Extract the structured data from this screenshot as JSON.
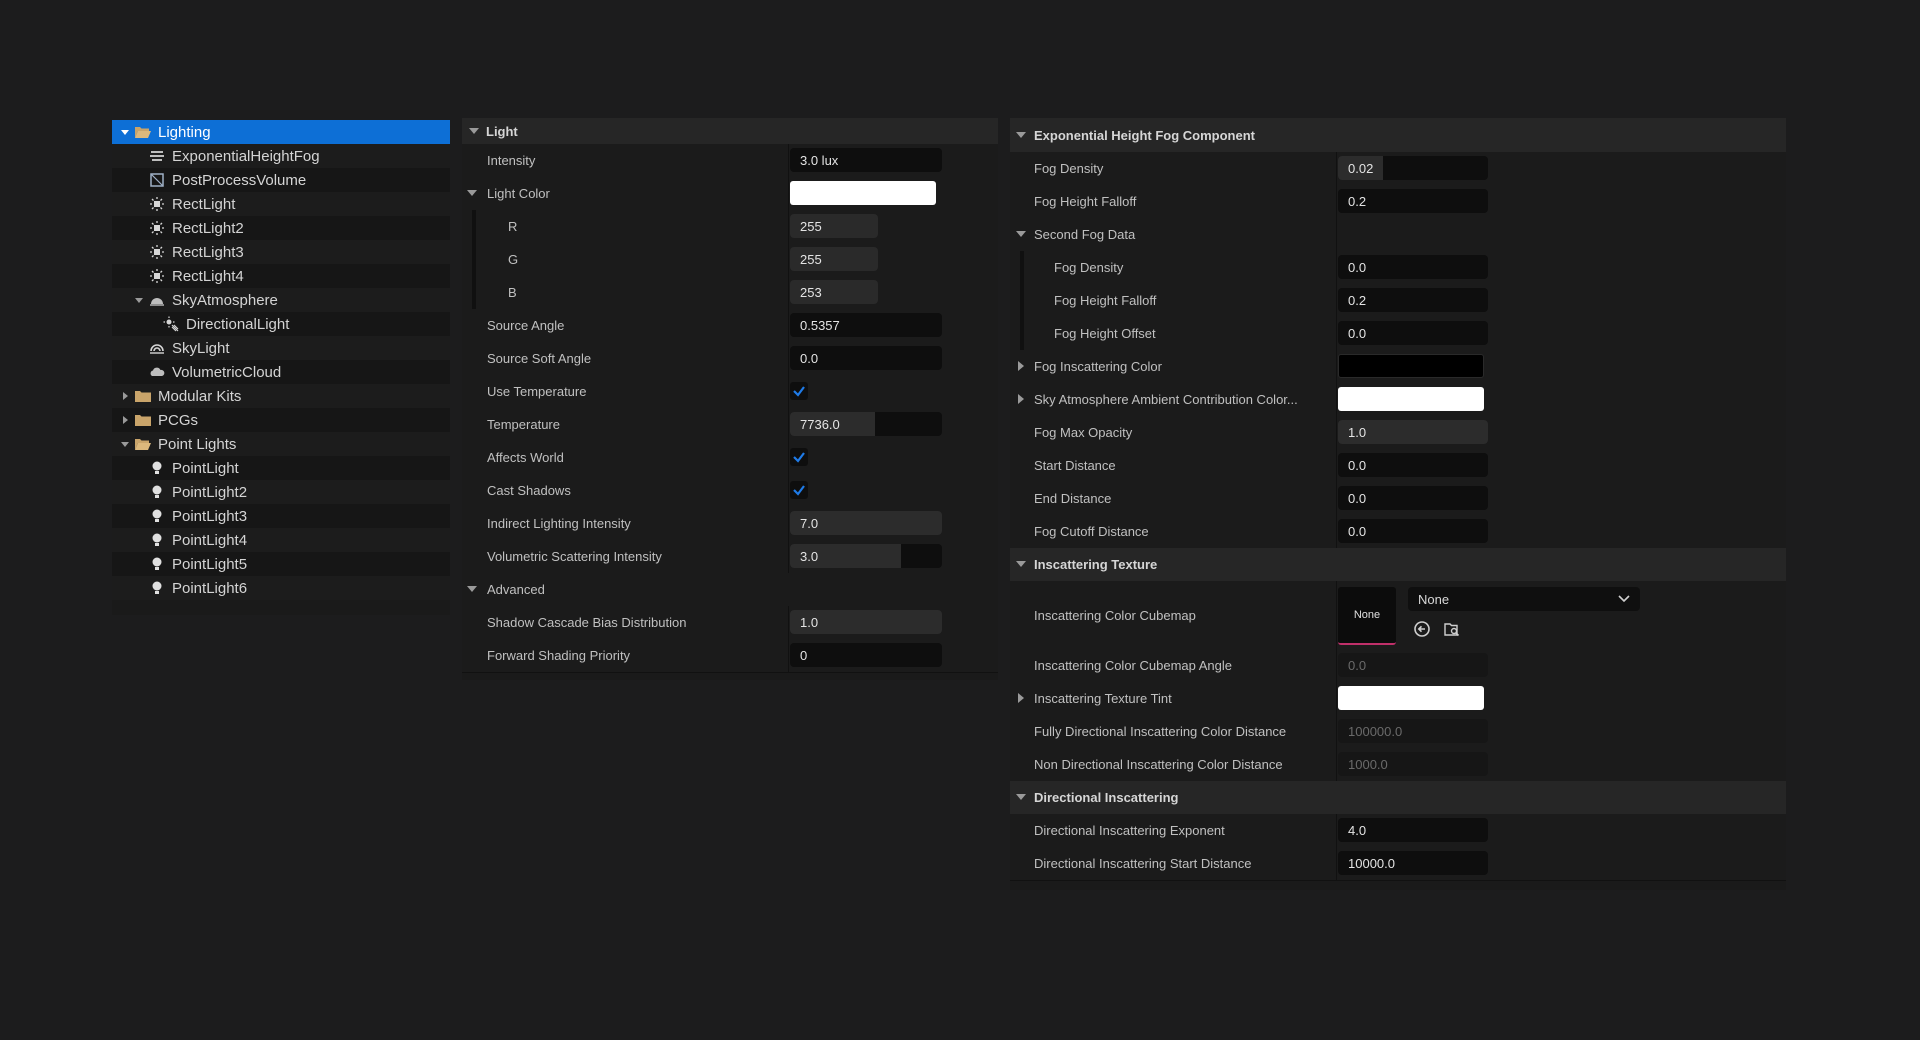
{
  "outliner": {
    "items": [
      {
        "label": "Lighting",
        "icon": "folder-open-icon",
        "depth": 0,
        "arrow": "expanded",
        "selected": true
      },
      {
        "label": "ExponentialHeightFog",
        "icon": "fog-icon",
        "depth": 1,
        "arrow": "none"
      },
      {
        "label": "PostProcessVolume",
        "icon": "post-process-icon",
        "depth": 1,
        "arrow": "none"
      },
      {
        "label": "RectLight",
        "icon": "rect-light-icon",
        "depth": 1,
        "arrow": "none"
      },
      {
        "label": "RectLight2",
        "icon": "rect-light-icon",
        "depth": 1,
        "arrow": "none"
      },
      {
        "label": "RectLight3",
        "icon": "rect-light-icon",
        "depth": 1,
        "arrow": "none"
      },
      {
        "label": "RectLight4",
        "icon": "rect-light-icon",
        "depth": 1,
        "arrow": "none"
      },
      {
        "label": "SkyAtmosphere",
        "icon": "sky-atmosphere-icon",
        "depth": 1,
        "arrow": "expanded"
      },
      {
        "label": "DirectionalLight",
        "icon": "directional-light-icon",
        "depth": 2,
        "arrow": "none"
      },
      {
        "label": "SkyLight",
        "icon": "sky-light-icon",
        "depth": 1,
        "arrow": "none"
      },
      {
        "label": "VolumetricCloud",
        "icon": "volumetric-cloud-icon",
        "depth": 1,
        "arrow": "none"
      },
      {
        "label": "Modular Kits",
        "icon": "folder-icon",
        "depth": 0,
        "arrow": "collapsed"
      },
      {
        "label": "PCGs",
        "icon": "folder-icon",
        "depth": 0,
        "arrow": "collapsed"
      },
      {
        "label": "Point Lights",
        "icon": "folder-open-icon",
        "depth": 0,
        "arrow": "expanded"
      },
      {
        "label": "PointLight",
        "icon": "point-light-icon",
        "depth": 1,
        "arrow": "none"
      },
      {
        "label": "PointLight2",
        "icon": "point-light-icon",
        "depth": 1,
        "arrow": "none"
      },
      {
        "label": "PointLight3",
        "icon": "point-light-icon",
        "depth": 1,
        "arrow": "none"
      },
      {
        "label": "PointLight4",
        "icon": "point-light-icon",
        "depth": 1,
        "arrow": "none"
      },
      {
        "label": "PointLight5",
        "icon": "point-light-icon",
        "depth": 1,
        "arrow": "none"
      },
      {
        "label": "PointLight6",
        "icon": "point-light-icon",
        "depth": 1,
        "arrow": "none"
      }
    ]
  },
  "light": {
    "header": "Light",
    "intensity": {
      "label": "Intensity",
      "value": "3.0 lux"
    },
    "light_color": {
      "label": "Light Color",
      "swatch": "#ffffff"
    },
    "r": {
      "label": "R",
      "value": "255"
    },
    "g": {
      "label": "G",
      "value": "255"
    },
    "b": {
      "label": "B",
      "value": "253"
    },
    "source_angle": {
      "label": "Source Angle",
      "value": "0.5357"
    },
    "source_soft_angle": {
      "label": "Source Soft Angle",
      "value": "0.0"
    },
    "use_temperature": {
      "label": "Use Temperature",
      "checked": true
    },
    "temperature": {
      "label": "Temperature",
      "value": "7736.0",
      "fill": 0.56
    },
    "affects_world": {
      "label": "Affects World",
      "checked": true
    },
    "cast_shadows": {
      "label": "Cast Shadows",
      "checked": true
    },
    "indirect": {
      "label": "Indirect Lighting Intensity",
      "value": "7.0",
      "fill": 1.0
    },
    "volumetric": {
      "label": "Volumetric Scattering Intensity",
      "value": "3.0",
      "fill": 0.73
    },
    "advanced_header": "Advanced",
    "shadow_cascade": {
      "label": "Shadow Cascade Bias Distribution",
      "value": "1.0",
      "fill": 1.0
    },
    "forward_priority": {
      "label": "Forward Shading Priority",
      "value": "0"
    }
  },
  "fog": {
    "header": "Exponential Height Fog Component",
    "fog_density": {
      "label": "Fog Density",
      "value": "0.02",
      "fill": 0.3
    },
    "fog_height_falloff": {
      "label": "Fog Height Falloff",
      "value": "0.2"
    },
    "second_fog_header": "Second Fog Data",
    "second_density": {
      "label": "Fog Density",
      "value": "0.0"
    },
    "second_falloff": {
      "label": "Fog Height Falloff",
      "value": "0.2"
    },
    "second_offset": {
      "label": "Fog Height Offset",
      "value": "0.0"
    },
    "inscattering_color": {
      "label": "Fog Inscattering Color",
      "swatch": "#000000"
    },
    "sky_ambient": {
      "label": "Sky Atmosphere Ambient Contribution Color...",
      "swatch": "#ffffff"
    },
    "max_opacity": {
      "label": "Fog Max Opacity",
      "value": "1.0",
      "fill": 1.0
    },
    "start_distance": {
      "label": "Start Distance",
      "value": "0.0"
    },
    "end_distance": {
      "label": "End Distance",
      "value": "0.0"
    },
    "cutoff_distance": {
      "label": "Fog Cutoff Distance",
      "value": "0.0"
    },
    "inscattering_texture_header": "Inscattering Texture",
    "cubemap": {
      "label": "Inscattering Color Cubemap",
      "thumb": "None",
      "dropdown": "None"
    },
    "cubemap_angle": {
      "label": "Inscattering Color Cubemap Angle",
      "value": "0.0"
    },
    "texture_tint": {
      "label": "Inscattering Texture Tint",
      "swatch": "#ffffff"
    },
    "fully_directional": {
      "label": "Fully Directional Inscattering Color Distance",
      "value": "100000.0"
    },
    "non_directional": {
      "label": "Non Directional Inscattering Color Distance",
      "value": "1000.0"
    },
    "directional_header": "Directional Inscattering",
    "dir_exponent": {
      "label": "Directional Inscattering Exponent",
      "value": "4.0"
    },
    "dir_start": {
      "label": "Directional Inscattering Start Distance",
      "value": "10000.0"
    }
  },
  "colors": {
    "selection": "#0d6fd6",
    "checkbox": "#1f7be8",
    "thumb_underline": "#c0306a"
  }
}
